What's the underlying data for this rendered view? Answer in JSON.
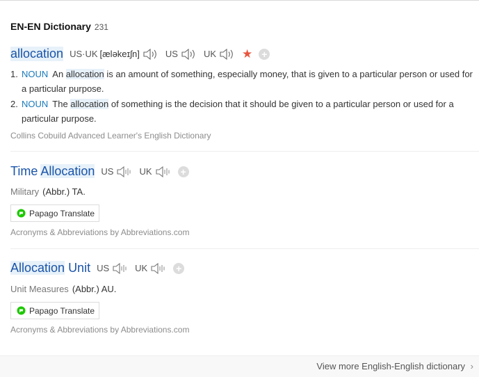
{
  "header": {
    "title": "EN-EN Dictionary",
    "count": "231"
  },
  "entry1": {
    "headword": "allocation",
    "us_uk_label": "US·UK",
    "pronunciation": "[æləkeɪʃn]",
    "us_label": "US",
    "uk_label": "UK",
    "definitions": [
      {
        "num": "1.",
        "pos": "NOUN",
        "pre": "An ",
        "hl": "allocation",
        "post": " is an amount of something, especially money, that is given to a particular person or used for a particular purpose."
      },
      {
        "num": "2.",
        "pos": "NOUN",
        "pre": "The ",
        "hl": "allocation",
        "post": " of something is the decision that it should be given to a particular person or used for a particular purpose."
      }
    ],
    "source": "Collins Cobuild Advanced Learner's English Dictionary"
  },
  "entry2": {
    "word1": "Time",
    "word2": "Allocation",
    "us_label": "US",
    "uk_label": "UK",
    "category": "Military",
    "abbr": "(Abbr.) TA.",
    "papago": "Papago Translate",
    "source": "Acronyms & Abbreviations by Abbreviations.com"
  },
  "entry3": {
    "word1": "Allocation",
    "word2": "Unit",
    "us_label": "US",
    "uk_label": "UK",
    "category": "Unit Measures",
    "abbr": "(Abbr.) AU.",
    "papago": "Papago Translate",
    "source": "Acronyms & Abbreviations by Abbreviations.com"
  },
  "footer": {
    "more_label": "View more English-English dictionary"
  },
  "colors": {
    "headword": "#1a54a8",
    "pos": "#1a7aba",
    "star": "#e8553e",
    "highlight": "#e7f1f9"
  },
  "icons": [
    "speaker-icon",
    "star-icon",
    "add-icon",
    "papago-icon",
    "chevron-right-icon"
  ]
}
